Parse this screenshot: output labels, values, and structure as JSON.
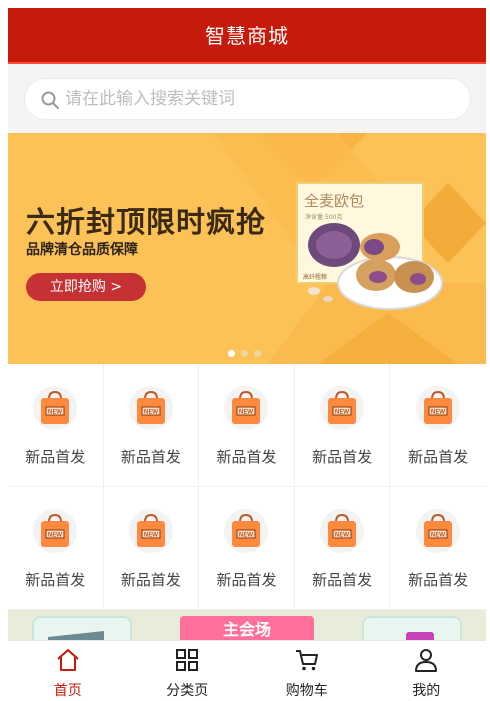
{
  "app": {
    "title": "智慧商城"
  },
  "search": {
    "placeholder": "请在此输入搜索关键词"
  },
  "banner": {
    "title": "六折封顶限时疯抢",
    "subtitle": "品牌清仓品质保障",
    "button_label": "立即抢购 >",
    "product_name": "全麦欧包",
    "product_fine_print": "净含量:500克",
    "product_tag": "高纤粗粮",
    "slide_count": 3,
    "active_slide": 1
  },
  "categories": [
    {
      "label": "新品首发",
      "badge": "NEW"
    },
    {
      "label": "新品首发",
      "badge": "NEW"
    },
    {
      "label": "新品首发",
      "badge": "NEW"
    },
    {
      "label": "新品首发",
      "badge": "NEW"
    },
    {
      "label": "新品首发",
      "badge": "NEW"
    },
    {
      "label": "新品首发",
      "badge": "NEW"
    },
    {
      "label": "新品首发",
      "badge": "NEW"
    },
    {
      "label": "新品首发",
      "badge": "NEW"
    },
    {
      "label": "新品首发",
      "badge": "NEW"
    },
    {
      "label": "新品首发",
      "badge": "NEW"
    }
  ],
  "venue": {
    "label": "主会场"
  },
  "tabbar": {
    "items": [
      {
        "label": "首页",
        "icon": "home-icon",
        "active": true
      },
      {
        "label": "分类页",
        "icon": "grid-icon",
        "active": false
      },
      {
        "label": "购物车",
        "icon": "cart-icon",
        "active": false
      },
      {
        "label": "我的",
        "icon": "user-icon",
        "active": false
      }
    ]
  },
  "colors": {
    "header": "#c61a0a",
    "banner": "#fdc257",
    "button": "#c63234",
    "active_tab": "#c61a0a",
    "bag": "#ff8a3d"
  }
}
